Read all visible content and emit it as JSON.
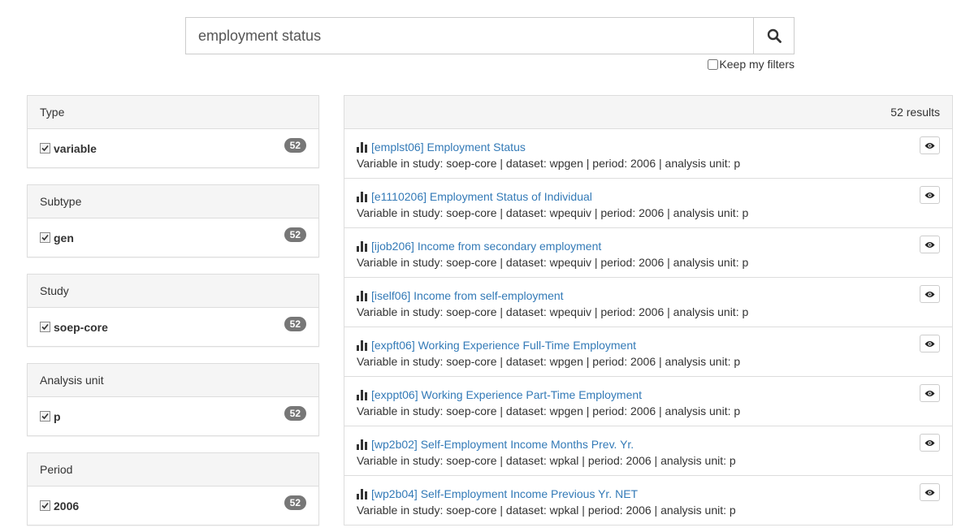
{
  "search": {
    "query": "employment status",
    "keep_filters_label": "Keep my filters"
  },
  "facets": [
    {
      "heading": "Type",
      "label": "variable",
      "count": "52"
    },
    {
      "heading": "Subtype",
      "label": "gen",
      "count": "52"
    },
    {
      "heading": "Study",
      "label": "soep-core",
      "count": "52"
    },
    {
      "heading": "Analysis unit",
      "label": "p",
      "count": "52"
    },
    {
      "heading": "Period",
      "label": "2006",
      "count": "52"
    }
  ],
  "results": {
    "count_label": "52 results",
    "items": [
      {
        "title": "[emplst06] Employment Status",
        "desc": "Variable in study: soep-core | dataset: wpgen | period: 2006 | analysis unit: p"
      },
      {
        "title": "[e1110206] Employment Status of Individual",
        "desc": "Variable in study: soep-core | dataset: wpequiv | period: 2006 | analysis unit: p"
      },
      {
        "title": "[ijob206] Income from secondary employment",
        "desc": "Variable in study: soep-core | dataset: wpequiv | period: 2006 | analysis unit: p"
      },
      {
        "title": "[iself06] Income from self-employment",
        "desc": "Variable in study: soep-core | dataset: wpequiv | period: 2006 | analysis unit: p"
      },
      {
        "title": "[expft06] Working Experience Full-Time Employment",
        "desc": "Variable in study: soep-core | dataset: wpgen | period: 2006 | analysis unit: p"
      },
      {
        "title": "[exppt06] Working Experience Part-Time Employment",
        "desc": "Variable in study: soep-core | dataset: wpgen | period: 2006 | analysis unit: p"
      },
      {
        "title": "[wp2b02] Self-Employment Income Months Prev. Yr.",
        "desc": "Variable in study: soep-core | dataset: wpkal | period: 2006 | analysis unit: p"
      },
      {
        "title": "[wp2b04] Self-Employment Income Previous Yr. NET",
        "desc": "Variable in study: soep-core | dataset: wpkal | period: 2006 | analysis unit: p"
      }
    ]
  },
  "colors": {
    "link": "#337ab7",
    "badge": "#777777",
    "panel_bg": "#f5f5f5",
    "border": "#dddddd"
  },
  "icons": {
    "search": "search-icon",
    "result_type": "bar-chart-icon",
    "preview": "eye-icon",
    "check": "checkbox-checked-icon"
  }
}
